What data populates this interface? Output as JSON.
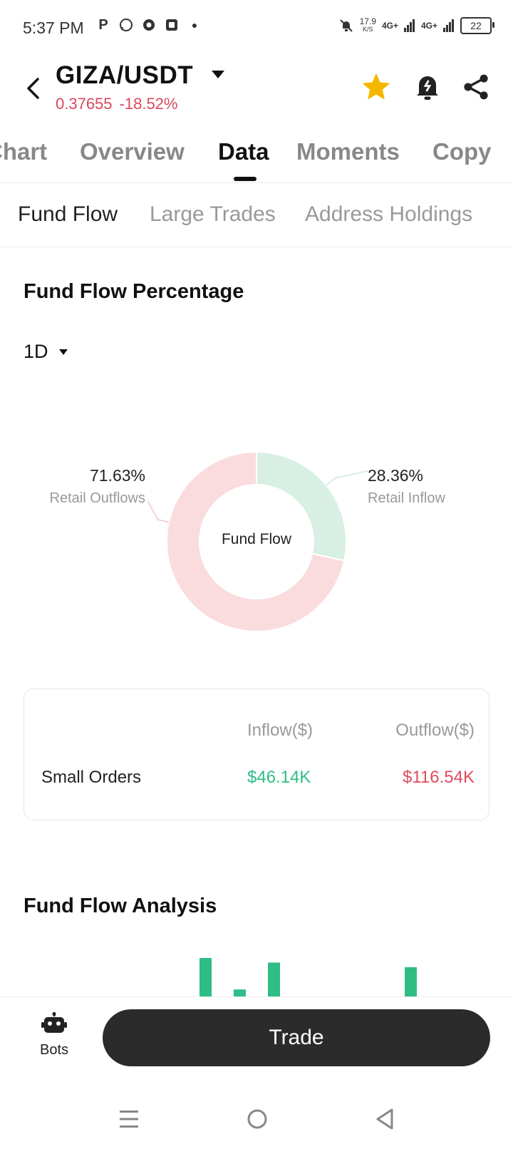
{
  "status_bar": {
    "time": "5:37 PM",
    "net_speed_value": "17.9",
    "net_speed_unit": "K/S",
    "signal_1": "4G+",
    "signal_2": "4G+",
    "battery": "22"
  },
  "header": {
    "pair": "GIZA/USDT",
    "price": "0.37655",
    "change": "-18.52%",
    "icons": [
      "back-arrow-icon",
      "caret-down-icon",
      "star-icon",
      "alert-bell-icon",
      "share-icon"
    ],
    "colors": {
      "star": "#f5b800",
      "negative": "#d9485e"
    }
  },
  "tabs": [
    {
      "label": "Chart",
      "active": false
    },
    {
      "label": "Overview",
      "active": false
    },
    {
      "label": "Data",
      "active": true
    },
    {
      "label": "Moments",
      "active": false
    },
    {
      "label": "Copy",
      "active": false
    }
  ],
  "subtabs": [
    {
      "label": "Fund Flow",
      "active": true
    },
    {
      "label": "Large Trades",
      "active": false
    },
    {
      "label": "Address Holdings",
      "active": false
    }
  ],
  "fund_flow_percentage": {
    "title": "Fund Flow Percentage",
    "period": "1D"
  },
  "chart_data": [
    {
      "type": "pie",
      "title": "Fund Flow",
      "slices": [
        {
          "label": "Retail Inflow",
          "value": 28.36,
          "display": "28.36%",
          "color": "#d8efe3"
        },
        {
          "label": "Retail Outflows",
          "value": 71.63,
          "display": "71.63%",
          "color": "#fadcde"
        }
      ]
    },
    {
      "type": "bar",
      "title": "Fund Flow Analysis",
      "values": [
        52,
        11,
        46,
        40
      ],
      "color": "#2ebd85",
      "note": "partially visible, no axes shown"
    }
  ],
  "orders_table": {
    "columns": [
      "Inflow($)",
      "Outflow($)"
    ],
    "rows": [
      {
        "label": "Small Orders",
        "inflow": "$46.14K",
        "outflow": "$116.54K"
      }
    ],
    "colors": {
      "inflow": "#2ebd85",
      "outflow": "#e04b5e"
    }
  },
  "analysis": {
    "title": "Fund Flow Analysis"
  },
  "bottom": {
    "bots_label": "Bots",
    "trade_label": "Trade"
  }
}
